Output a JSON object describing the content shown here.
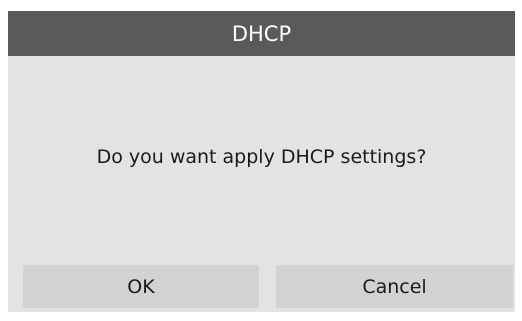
{
  "dialog": {
    "title": "DHCP",
    "message": "Do you want apply DHCP settings?",
    "ok_label": "OK",
    "cancel_label": "Cancel"
  },
  "colors": {
    "titlebar_bg": "#5a5a5a",
    "dialog_bg": "#e3e3e3",
    "button_bg": "#d2d2d2",
    "text": "#1a1a1a"
  }
}
